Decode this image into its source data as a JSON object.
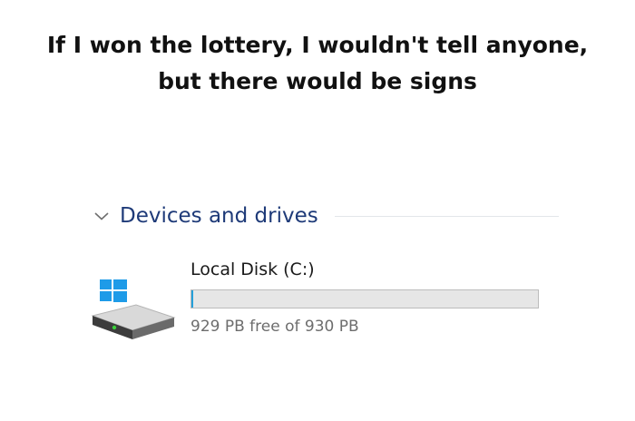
{
  "caption": {
    "line1": "If I won the lottery, I wouldn't tell anyone,",
    "line2": "but there would be signs"
  },
  "section": {
    "title": "Devices and drives",
    "chevron_icon": "chevron-down-icon",
    "title_color": "#1e3a78"
  },
  "drive": {
    "name": "Local Disk (C:)",
    "free_text": "929 PB free of 930 PB",
    "icon": "windows-drive-icon",
    "used_fraction": 0.0011,
    "bar_fill_color": "#26a0da",
    "bar_track_color": "#e6e6e6"
  }
}
